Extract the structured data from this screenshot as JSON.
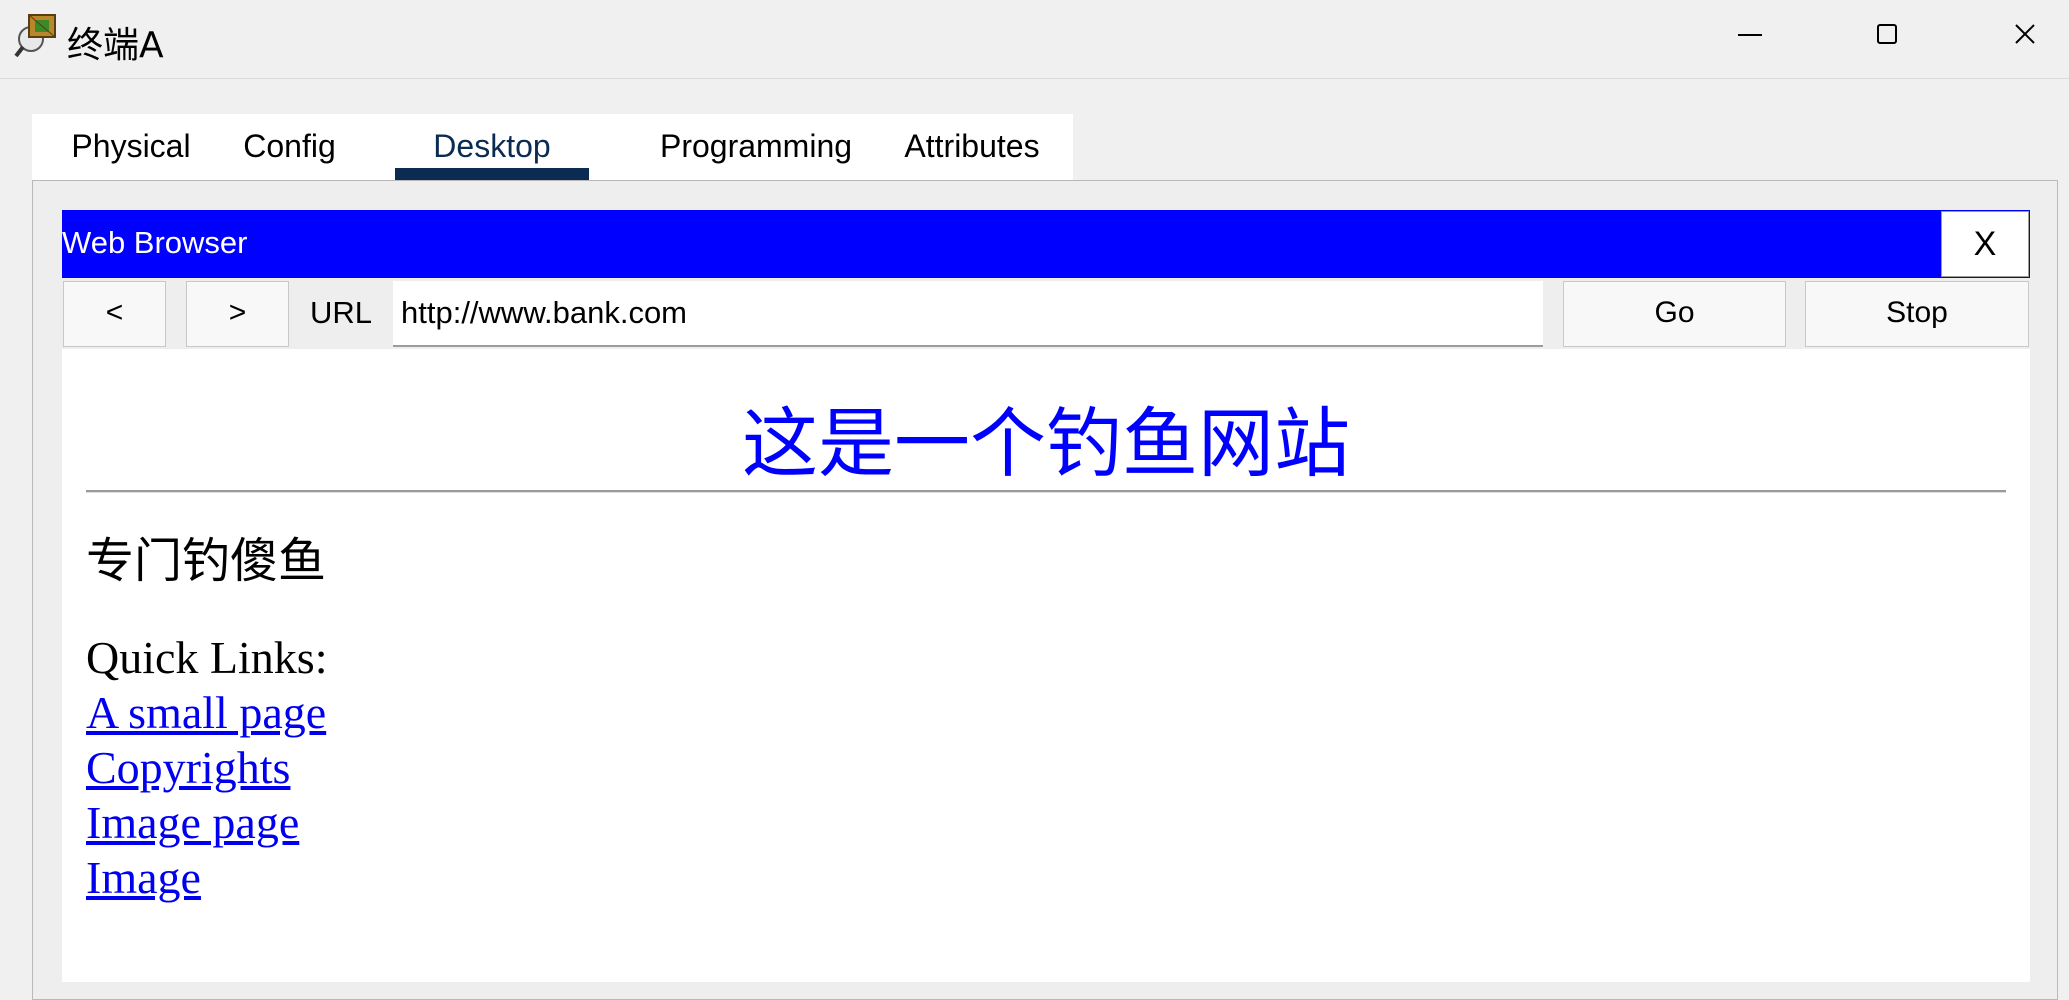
{
  "window": {
    "title": "终端A",
    "app_icon": "packet-tracer-pc-icon",
    "controls": [
      "minimize-icon",
      "maximize-icon",
      "close-icon"
    ]
  },
  "tabs": [
    {
      "label": "Physical",
      "active": false
    },
    {
      "label": "Config",
      "active": false
    },
    {
      "label": "Desktop",
      "active": true
    },
    {
      "label": "Programming",
      "active": false
    },
    {
      "label": "Attributes",
      "active": false
    }
  ],
  "browser": {
    "title": "Web Browser",
    "close_label": "X",
    "back_label": "<",
    "forward_label": ">",
    "url_label": "URL",
    "url_value": "http://www.bank.com",
    "go_label": "Go",
    "stop_label": "Stop"
  },
  "page": {
    "heading": "这是一个钓鱼网站",
    "subtitle": "专门钓傻鱼",
    "quick_links_label": "Quick Links:",
    "links": [
      "A small page",
      "Copyrights",
      "Image page",
      "Image"
    ]
  },
  "colors": {
    "browser_bar": "#0000ff",
    "heading": "#0000ff",
    "link": "#0000ee",
    "active_tab": "#0c2b52"
  }
}
